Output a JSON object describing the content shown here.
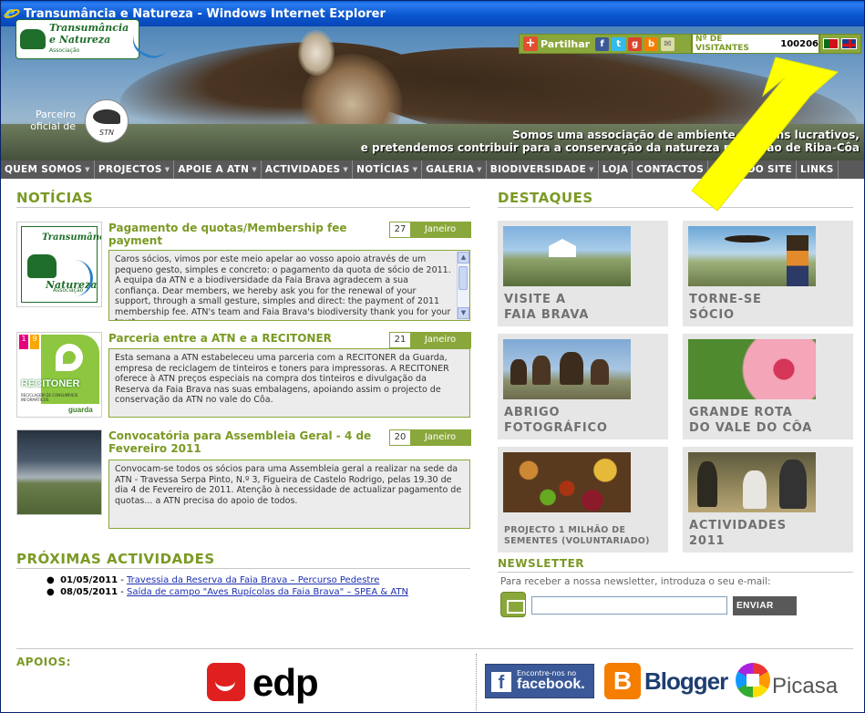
{
  "window": {
    "title": "Transumância e Natureza - Windows Internet Explorer"
  },
  "header": {
    "logo": {
      "line1": "Transumância",
      "line2": "e Natureza",
      "line3": "Associação"
    },
    "partner_label": "Parceiro oficial de",
    "partner_logo": "STN",
    "slogan_line1": "Somos uma associação de ambiente sem fins lucrativos,",
    "slogan_line2": "e pretendemos contribuir para a conservação da natureza na região de Riba-Côa",
    "share_label": "Partilhar",
    "share_icons": [
      "facebook-icon",
      "twitter-icon",
      "google-plus-icon",
      "blogger-icon",
      "email-icon"
    ],
    "visitors_label": "Nº DE VISITANTES",
    "visitors_count": "100206",
    "languages": [
      "pt",
      "en"
    ]
  },
  "nav": {
    "items": [
      {
        "label": "QUEM SOMOS",
        "dropdown": true
      },
      {
        "label": "PROJECTOS",
        "dropdown": true
      },
      {
        "label": "APOIE A ATN",
        "dropdown": true
      },
      {
        "label": "ACTIVIDADES",
        "dropdown": true
      },
      {
        "label": "NOTÍCIAS",
        "dropdown": true
      },
      {
        "label": "GALERIA",
        "dropdown": true
      },
      {
        "label": "BIODIVERSIDADE",
        "dropdown": true
      },
      {
        "label": "LOJA",
        "dropdown": false
      },
      {
        "label": "CONTACTOS",
        "dropdown": false
      },
      {
        "label": "MAPA DO SITE",
        "dropdown": false
      },
      {
        "label": "LINKS",
        "dropdown": false
      }
    ]
  },
  "news": {
    "title": "NOTÍCIAS",
    "items": [
      {
        "title": "Pagamento de quotas/Membership fee payment",
        "day": "27",
        "month": "Janeiro",
        "body": "Caros sócios, vimos por este meio apelar ao vosso apoio através de um pequeno gesto, simples e concreto: o pagamento da quota de sócio de 2011. A equipa da ATN e a biodiversidade da Faia Brava agradecem a sua confiança. Dear members, we hereby ask you for the renewal of your support, through a small gesture, simples and direct: the payment of 2011 membership fee. ATN's team and Faia Brava's biodiversity thank you for your trust."
      },
      {
        "title": "Parceria entre a ATN e a RECITONER",
        "day": "21",
        "month": "Janeiro",
        "body": "Esta semana a ATN estabeleceu uma parceria com a RECITONER da Guarda, empresa de reciclagem de tinteiros e toners para impressoras. A RECITONER oferece à ATN preços especiais na compra dos tinteiros e divulgação da Reserva da Faia Brava nas suas embalagens, apoiando assim o projecto de conservação da ATN no vale do Côa."
      },
      {
        "title": "Convocatória para Assembleia Geral - 4 de Fevereiro 2011",
        "day": "20",
        "month": "Janeiro",
        "body": "Convocam-se todos os sócios para uma Assembleia geral a realizar na sede da ATN - Travessa Serpa Pinto, N.º 3, Figueira de Castelo Rodrigo, pelas 19.30 de dia 4 de Fevereiro de 2011. Atenção à necessidade de actualizar pagamento de quotas... a ATN precisa do apoio de todos."
      }
    ],
    "thumb_texts": {
      "logo_l1": "Transumância",
      "logo_l2": "e Natureza",
      "logo_l3": "Associação",
      "reci_top": "1 9",
      "reci_brand1": "RECI",
      "reci_brand2": "TONER",
      "reci_sub": "RECICLAGEM DE CONSUMÍVEIS INFORMÁTICOS",
      "reci_city": "guarda"
    }
  },
  "activities": {
    "title": "PRÓXIMAS ACTIVIDADES",
    "items": [
      {
        "date": "01/05/2011",
        "sep": " - ",
        "label": "Travessia da Reserva da Faia Brava – Percurso Pedestre"
      },
      {
        "date": "08/05/2011",
        "sep": " - ",
        "label": "Saída de campo \"Aves Rupícolas da Faia Brava\" – SPEA & ATN"
      }
    ]
  },
  "highlights": {
    "title": "DESTAQUES",
    "items": [
      {
        "line1": "VISITE A",
        "line2": "FAIA BRAVA"
      },
      {
        "line1": "TORNE-SE",
        "line2": "SÓCIO"
      },
      {
        "line1": "ABRIGO",
        "line2": "FOTOGRÁFICO"
      },
      {
        "line1": "GRANDE ROTA",
        "line2": "DO VALE DO CÔA"
      },
      {
        "line1": "PROJECTO 1 MILHÃO DE",
        "line2": "SEMENTES (VOLUNTARIADO)"
      },
      {
        "line1": "ACTIVIDADES",
        "line2": "2011"
      }
    ]
  },
  "newsletter": {
    "title": "NEWSLETTER",
    "text": "Para receber a nossa newsletter, introduza o seu e-mail:",
    "input_value": "",
    "button": "ENVIAR"
  },
  "footer": {
    "apoios": "APOIOS:",
    "edp": "edp",
    "facebook_small": "Encontre-nos no",
    "facebook_big": "facebook.",
    "blogger": "Blogger",
    "picasa": "Picasa"
  },
  "colors": {
    "accent_green": "#7a9a24",
    "nav_gray": "#595959",
    "arrow_yellow": "#ffff00"
  }
}
